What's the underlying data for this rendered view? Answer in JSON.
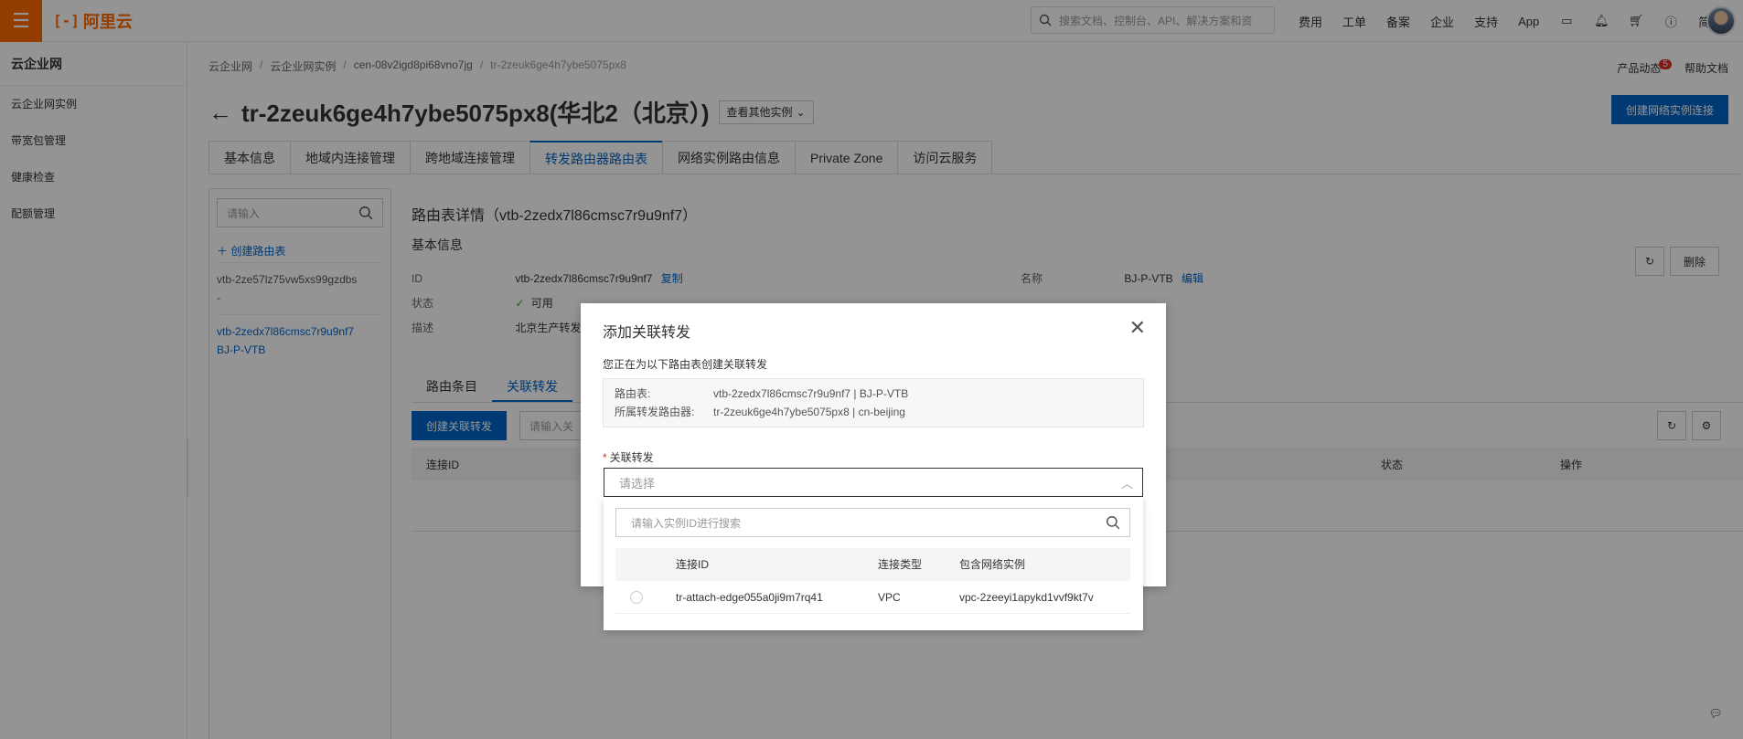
{
  "topbar": {
    "logo_text": "阿里云",
    "logo_mark": "[-]",
    "search_placeholder": "搜索文档、控制台、API、解决方案和资",
    "links": [
      "费用",
      "工单",
      "备案",
      "企业",
      "支持",
      "App"
    ],
    "lang": "简体",
    "brand_color": "#ff6a00"
  },
  "sidebar": {
    "title": "云企业网",
    "items": [
      {
        "label": "云企业网实例"
      },
      {
        "label": "带宽包管理"
      },
      {
        "label": "健康检查"
      },
      {
        "label": "配额管理"
      }
    ]
  },
  "breadcrumb": {
    "items": [
      "云企业网",
      "云企业网实例",
      "cen-08v2igd8pi68vno7jg",
      "tr-2zeuk6ge4h7ybe5075px8"
    ]
  },
  "header": {
    "product_news": "产品动态",
    "badge_count": "5",
    "help_docs": "帮助文档",
    "title": "tr-2zeuk6ge4h7ybe5075px8(华北2（北京）)",
    "other_instances": "查看其他实例",
    "create_button": "创建网络实例连接",
    "accent_color": "#0064c8"
  },
  "tabs": [
    {
      "label": "基本信息"
    },
    {
      "label": "地域内连接管理"
    },
    {
      "label": "跨地域连接管理"
    },
    {
      "label": "转发路由器路由表"
    },
    {
      "label": "网络实例路由信息"
    },
    {
      "label": "Private Zone"
    },
    {
      "label": "访问云服务"
    }
  ],
  "route_tables": {
    "search_placeholder": "请输入",
    "create_label": "创建路由表",
    "items": [
      {
        "id": "vtb-2ze57lz75vw5xs99gzdbs",
        "name": "-"
      },
      {
        "id": "vtb-2zedx7l86cmsc7r9u9nf7",
        "name": "BJ-P-VTB"
      }
    ]
  },
  "detail": {
    "title": "路由表详情（vtb-2zedx7l86cmsc7r9u9nf7）",
    "section": "基本信息",
    "id_label": "ID",
    "id_value": "vtb-2zedx7l86cmsc7r9u9nf7",
    "copy_label": "复制",
    "status_label": "状态",
    "status_value": "可用",
    "desc_label": "描述",
    "desc_value": "北京生产转发",
    "name_label": "名称",
    "name_value": "BJ-P-VTB",
    "edit_label": "编辑",
    "delete_label": "删除"
  },
  "subtabs": [
    {
      "label": "路由条目"
    },
    {
      "label": "关联转发"
    }
  ],
  "assoc": {
    "create_button": "创建关联转发",
    "search_placeholder": "请输入关",
    "columns": [
      "连接ID",
      "状态",
      "操作"
    ]
  },
  "modal": {
    "title": "添加关联转发",
    "description": "您正在为以下路由表创建关联转发",
    "route_table_label": "路由表:",
    "route_table_value": "vtb-2zedx7l86cmsc7r9u9nf7 | BJ-P-VTB",
    "router_label": "所属转发路由器:",
    "router_value": "tr-2zeuk6ge4h7ybe5075px8 | cn-beijing",
    "field_label": "关联转发",
    "select_placeholder": "请选择",
    "dropdown": {
      "search_placeholder": "请输入实例ID进行搜索",
      "columns": [
        "连接ID",
        "连接类型",
        "包含网络实例"
      ],
      "rows": [
        {
          "id": "tr-attach-edge055a0ji9m7rq41",
          "type": "VPC",
          "instance": "vpc-2zeeyi1apykd1vvf9kt7v"
        }
      ]
    }
  }
}
